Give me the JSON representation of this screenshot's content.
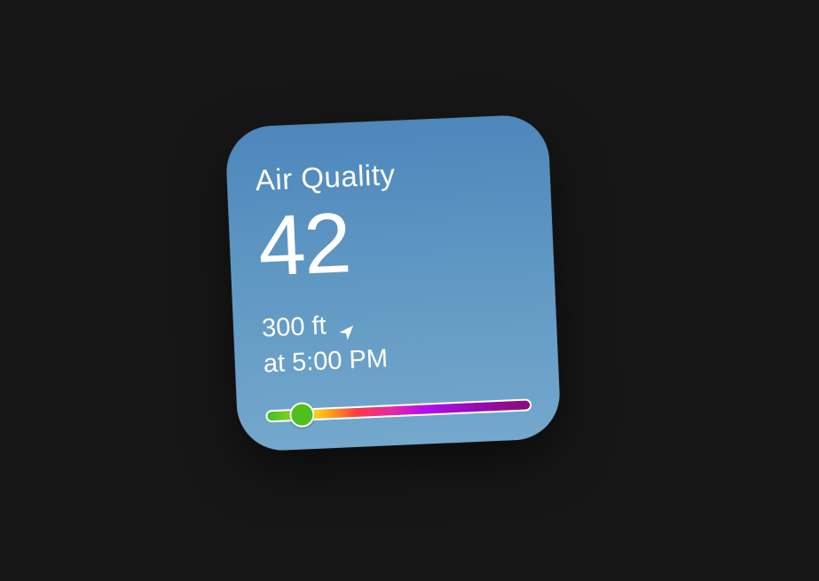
{
  "widget": {
    "title": "Air Quality",
    "aqi_value": "42",
    "elevation": "300 ft",
    "time_label": "at 5:00 PM",
    "location_icon": "location-arrow-icon",
    "scale_position": 0.13,
    "colors": {
      "background_top": "#4d87bb",
      "background_bottom": "#74a8cc",
      "indicator": "#4fbf1c"
    }
  }
}
